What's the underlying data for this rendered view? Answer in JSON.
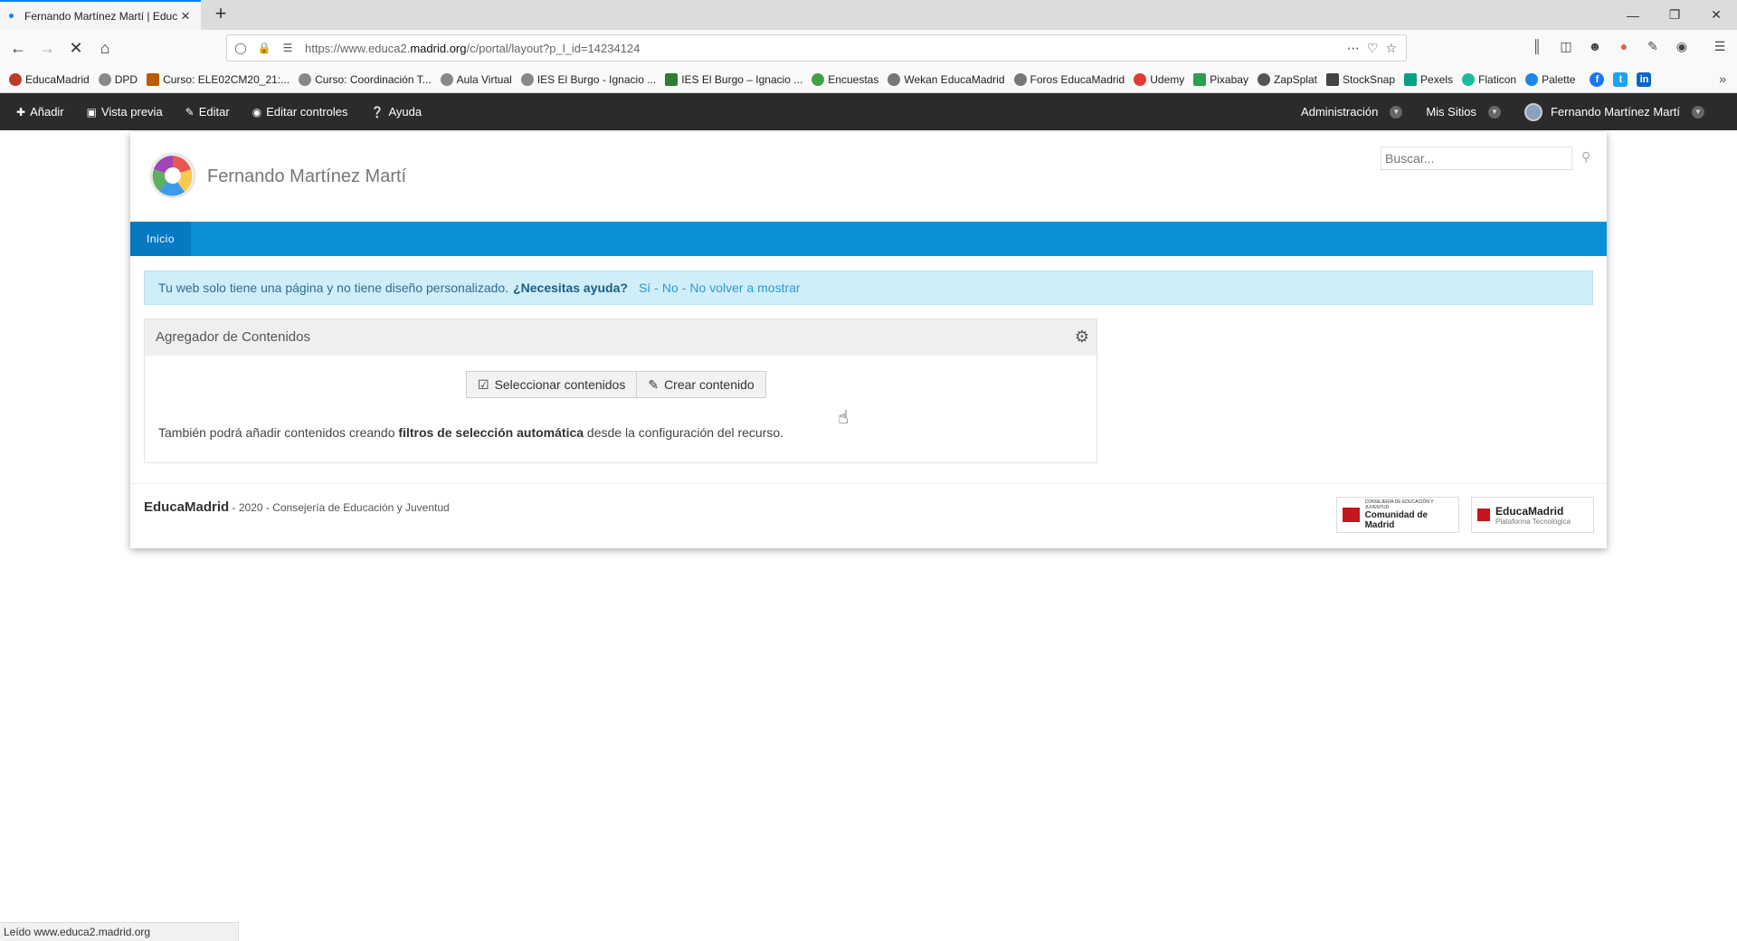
{
  "browser": {
    "tab_title": "Fernando Martínez Martí | Educ...",
    "url_prefix": "https://www.educa2.",
    "url_host": "madrid.org",
    "url_path": "/c/portal/layout?p_l_id=14234124",
    "status_text": "Leído www.educa2.madrid.org"
  },
  "bookmarks": [
    {
      "label": "EducaMadrid",
      "color": "#c0392b"
    },
    {
      "label": "DPD",
      "color": "#888888"
    },
    {
      "label": "Curso: ELE02CM20_21:...",
      "color": "#b85c00"
    },
    {
      "label": "Curso: Coordinación T...",
      "color": "#888888"
    },
    {
      "label": "Aula Virtual",
      "color": "#888888"
    },
    {
      "label": "IES El Burgo - Ignacio ...",
      "color": "#888888"
    },
    {
      "label": "IES El Burgo – Ignacio ...",
      "color": "#2e7d32"
    },
    {
      "label": "Encuestas",
      "color": "#43a047"
    },
    {
      "label": "Wekan EducaMadrid",
      "color": "#777777"
    },
    {
      "label": "Foros EducaMadrid",
      "color": "#777777"
    },
    {
      "label": "Udemy",
      "color": "#e53935"
    },
    {
      "label": "Pixabay",
      "color": "#2e9e4f"
    },
    {
      "label": "ZapSplat",
      "color": "#555555"
    },
    {
      "label": "StockSnap",
      "color": "#444444"
    },
    {
      "label": "Pexels",
      "color": "#05a081"
    },
    {
      "label": "Flaticon",
      "color": "#1abc9c"
    },
    {
      "label": "Palette",
      "color": "#1e88e5"
    }
  ],
  "dockbar": {
    "add": "Añadir",
    "preview": "Vista previa",
    "edit": "Editar",
    "edit_controls": "Editar controles",
    "help": "Ayuda",
    "admin": "Administración",
    "my_sites": "Mis Sitios",
    "user": "Fernando Martínez Martí"
  },
  "site": {
    "title": "Fernando Martínez Martí",
    "search_placeholder": "Buscar...",
    "nav_home": "Inicio"
  },
  "alert": {
    "message": "Tu web solo tiene una página y no tiene diseño personalizado.",
    "help_question": "¿Necesitas ayuda?",
    "yes": "Sí",
    "no": "No",
    "dont_show": "No volver a mostrar"
  },
  "portlet": {
    "title": "Agregador de Contenidos",
    "select_button": "Seleccionar contenidos",
    "create_button": "Crear contenido",
    "info_before": "También podrá añadir contenidos creando ",
    "info_bold": "filtros de selección automática",
    "info_after": " desde la configuración del recurso."
  },
  "footer": {
    "brand": "EducaMadrid",
    "text": " - 2020 - Consejería de Educación y Juventud",
    "logo1_top": "CONSEJERÍA DE EDUCACIÓN Y JUVENTUD",
    "logo1_main": "Comunidad de Madrid",
    "logo2_main": "EducaMadrid",
    "logo2_sub": "Plataforma Tecnológica"
  },
  "colors": {
    "dockbar": "#2b2b2b",
    "menubar": "#0a90d7",
    "menu_active": "#0679c2",
    "alert_bg": "#d0eef9"
  }
}
